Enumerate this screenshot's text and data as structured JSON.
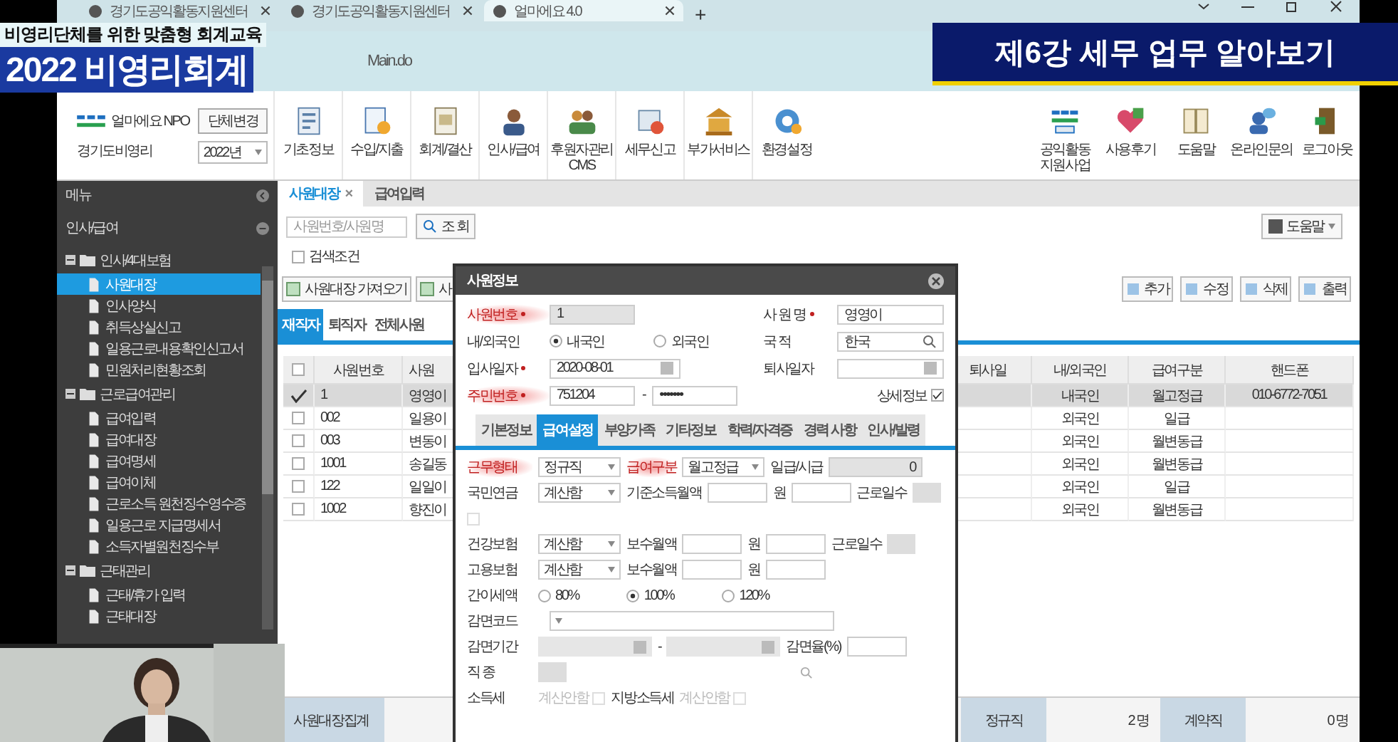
{
  "overlay": {
    "subtitle": "비영리단체를 위한 맞춤형 회계교육",
    "title": "2022 비영리회계",
    "lecture": "제6강 세무 업무 알아보기"
  },
  "browser": {
    "tabs": [
      {
        "label": "경기도공익활동지원센터",
        "selected": false
      },
      {
        "label": "경기도공익활동지원센터",
        "selected": false
      },
      {
        "label": "얼마에요 4.0",
        "selected": true
      }
    ],
    "new_tab": "+",
    "address": "Main.do"
  },
  "app": {
    "brand": "얼마에요 NPO",
    "change_button": "단체변경",
    "org": "경기도비영리",
    "year": "2022년",
    "menu": [
      "기초정보",
      "수입/지출",
      "회계/결산",
      "인사/급여",
      "후원자관리 CMS",
      "세무신고",
      "부가서비스",
      "환경설정"
    ],
    "right_menu": [
      "공익활동 지원사업",
      "사용후기",
      "도움말",
      "온라인문의",
      "로그아웃"
    ]
  },
  "sidebar": {
    "title": "메뉴",
    "section": "인사/급여",
    "tree": [
      {
        "label": "인사/4대보험",
        "expanded": true,
        "children": [
          {
            "label": "사원대장",
            "selected": true
          },
          {
            "label": "인사양식",
            "selected": false
          },
          {
            "label": "취득상실신고",
            "selected": false
          },
          {
            "label": "일용근로내용확인신고서",
            "selected": false
          },
          {
            "label": "민원처리현황조회",
            "selected": false
          }
        ]
      },
      {
        "label": "근로급여관리",
        "expanded": true,
        "children": [
          {
            "label": "급여입력",
            "selected": false
          },
          {
            "label": "급여대장",
            "selected": false
          },
          {
            "label": "급여명세",
            "selected": false
          },
          {
            "label": "급여이체",
            "selected": false
          },
          {
            "label": "근로소득 원천징수영수증",
            "selected": false
          },
          {
            "label": "일용근로 지급명세서",
            "selected": false
          },
          {
            "label": "소득자별원천징수부",
            "selected": false
          }
        ]
      },
      {
        "label": "근태관리",
        "expanded": true,
        "children": [
          {
            "label": "근태/휴가 입력",
            "selected": false
          },
          {
            "label": "근태대장",
            "selected": false
          }
        ]
      }
    ]
  },
  "main": {
    "doc_tabs": [
      {
        "label": "사원대장",
        "selected": true,
        "close": "×"
      },
      {
        "label": "급여입력",
        "selected": false
      }
    ],
    "search": {
      "placeholder": "사원번호/사원명",
      "button": "조 회"
    },
    "filter": {
      "label": "검색조건",
      "checked": false
    },
    "import_buttons": [
      "사원대장 가져오기",
      "사"
    ],
    "help": "도움말",
    "actions": [
      "추가",
      "수정",
      "삭제",
      "출력"
    ],
    "list_tabs": [
      {
        "label": "재직자",
        "selected": true
      },
      {
        "label": "퇴직자",
        "selected": false
      },
      {
        "label": "전체사원",
        "selected": false
      }
    ],
    "table": {
      "all_checked": false,
      "columns_left": [
        "사원번호",
        "사원"
      ],
      "columns_right": [
        "퇴사일",
        "내/외국인",
        "급여구분",
        "핸드폰"
      ],
      "rows": [
        {
          "checked": true,
          "selected": true,
          "number": "1",
          "name": "영영이",
          "nationality": "내국인",
          "pay_type": "월고정급",
          "phone": "010-6772-7051"
        },
        {
          "checked": false,
          "selected": false,
          "number": "002",
          "name": "일용이",
          "nationality": "외국인",
          "pay_type": "일급"
        },
        {
          "checked": false,
          "selected": false,
          "number": "003",
          "name": "변동이",
          "nationality": "외국인",
          "pay_type": "월변동급"
        },
        {
          "checked": false,
          "selected": false,
          "number": "1001",
          "name": "송길동",
          "nationality": "외국인",
          "pay_type": "월변동급"
        },
        {
          "checked": false,
          "selected": false,
          "number": "122",
          "name": "일일이",
          "nationality": "외국인",
          "pay_type": "일급"
        },
        {
          "checked": false,
          "selected": false,
          "number": "1002",
          "name": "향진이",
          "nationality": "외국인",
          "pay_type": "월변동급"
        }
      ]
    },
    "summary": {
      "title": "사원대장집계",
      "items": [
        {
          "label": "정규직",
          "value": "2 명"
        },
        {
          "label": "계약직",
          "value": "0 명"
        }
      ]
    }
  },
  "dialog": {
    "title": "사원정보",
    "header_rows": [
      [
        {
          "label": "사원번호",
          "required": true,
          "highlighted": true,
          "controls": [
            {
              "kind": "input",
              "value": "1",
              "disabled": true
            }
          ]
        },
        {
          "label": "사 원 명",
          "required": true,
          "highlighted": false,
          "controls": [
            {
              "kind": "input",
              "value": "영영이",
              "disabled": false
            }
          ]
        }
      ],
      [
        {
          "label": "내/외국인",
          "required": false,
          "highlighted": false,
          "controls": [
            {
              "kind": "radio",
              "label": "내국인",
              "selected": true
            },
            {
              "kind": "radio",
              "label": "외국인",
              "selected": false
            }
          ]
        },
        {
          "label": "국 적",
          "required": false,
          "highlighted": false,
          "controls": [
            {
              "kind": "search",
              "value": "한국"
            }
          ]
        }
      ],
      [
        {
          "label": "입사일자",
          "required": true,
          "highlighted": false,
          "controls": [
            {
              "kind": "date",
              "value": "2020-08-01"
            }
          ]
        },
        {
          "label": "퇴사일자",
          "required": false,
          "highlighted": false,
          "controls": [
            {
              "kind": "date"
            }
          ]
        }
      ],
      [
        {
          "label": "주민번호",
          "required": true,
          "highlighted": true,
          "controls": [
            {
              "kind": "input",
              "value": "751204",
              "disabled": false
            },
            {
              "kind": "text",
              "text": "-"
            },
            {
              "kind": "input",
              "value": "•••••••",
              "disabled": false
            }
          ]
        },
        {
          "required": false,
          "highlighted": false,
          "controls": [
            {
              "kind": "check",
              "label": "상세정보",
              "checked": true,
              "disabled": false
            }
          ]
        }
      ]
    ],
    "tabs": [
      {
        "label": "기본정보",
        "selected": false
      },
      {
        "label": "급여설정",
        "selected": true
      },
      {
        "label": "부양가족",
        "selected": false
      },
      {
        "label": "기타정보",
        "selected": false
      },
      {
        "label": "학력/자격증",
        "selected": false
      },
      {
        "label": "경력 사항",
        "selected": false
      },
      {
        "label": "인사/발령",
        "selected": false
      }
    ],
    "form_rows": [
      [
        {
          "kind": "label",
          "text": "근무형태",
          "highlighted": true
        },
        {
          "kind": "select",
          "value": "정규직"
        },
        {
          "kind": "label",
          "text": "급여구분",
          "highlighted": true
        },
        {
          "kind": "select",
          "value": "월고정급"
        },
        {
          "kind": "label",
          "text": "일급/시급",
          "highlighted": false
        },
        {
          "kind": "input",
          "value": "0",
          "disabled": true
        }
      ],
      [
        {
          "kind": "label",
          "text": "국민연금",
          "highlighted": false
        },
        {
          "kind": "select",
          "value": "계산함"
        },
        {
          "kind": "label",
          "text": "기준소득월액",
          "highlighted": false
        },
        {
          "kind": "input",
          "disabled": false
        },
        {
          "kind": "unit",
          "text": "원"
        },
        {
          "kind": "input",
          "disabled": false
        },
        {
          "kind": "label",
          "text": "근로일수",
          "highlighted": false
        },
        {
          "kind": "mini"
        }
      ],
      [
        {
          "kind": "check",
          "checked": false,
          "disabled": true
        }
      ],
      [
        {
          "kind": "label",
          "text": "건강보험",
          "highlighted": false
        },
        {
          "kind": "select",
          "value": "계산함"
        },
        {
          "kind": "label",
          "text": "보수월액",
          "highlighted": false
        },
        {
          "kind": "input",
          "disabled": false
        },
        {
          "kind": "unit",
          "text": "원"
        },
        {
          "kind": "input",
          "disabled": false
        },
        {
          "kind": "label",
          "text": "근로일수",
          "highlighted": false
        },
        {
          "kind": "mini"
        }
      ],
      [
        {
          "kind": "label",
          "text": "고용보험",
          "highlighted": false
        },
        {
          "kind": "select",
          "value": "계산함"
        },
        {
          "kind": "label",
          "text": "보수월액",
          "highlighted": false
        },
        {
          "kind": "input",
          "disabled": false
        },
        {
          "kind": "unit",
          "text": "원"
        },
        {
          "kind": "input",
          "disabled": false
        }
      ],
      [
        {
          "kind": "label",
          "text": "간이세액",
          "highlighted": false
        },
        {
          "kind": "radio",
          "label": "80%",
          "selected": false
        },
        {
          "kind": "radio",
          "label": "100%",
          "selected": true
        },
        {
          "kind": "radio",
          "label": "120%",
          "selected": false
        }
      ],
      [
        {
          "kind": "label",
          "text": "감면코드",
          "highlighted": false
        },
        {
          "kind": "combo"
        }
      ],
      [
        {
          "kind": "label",
          "text": "감면기간",
          "highlighted": false
        },
        {
          "kind": "date"
        },
        {
          "kind": "unit",
          "text": "-"
        },
        {
          "kind": "date"
        },
        {
          "kind": "label",
          "text": "감면율(%)",
          "highlighted": false
        },
        {
          "kind": "input",
          "disabled": false
        }
      ],
      [
        {
          "kind": "label",
          "text": "직 종",
          "highlighted": false
        },
        {
          "kind": "mini"
        },
        {
          "kind": "lookup"
        }
      ],
      [
        {
          "kind": "label",
          "text": "소득세",
          "highlighted": false
        },
        {
          "kind": "check",
          "label": "계산안함",
          "checked": false,
          "disabled": true
        },
        {
          "kind": "label",
          "text": "지방소득세",
          "highlighted": false
        },
        {
          "kind": "check",
          "label": "계산안함",
          "checked": false,
          "disabled": true
        }
      ]
    ]
  }
}
